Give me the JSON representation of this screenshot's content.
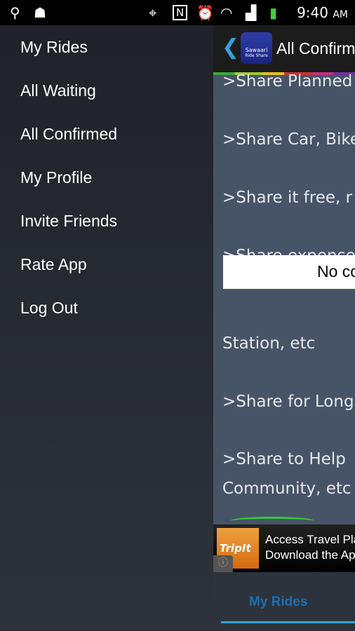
{
  "status_bar": {
    "time": "9:40",
    "ampm": "AM",
    "icons": [
      "usb-icon",
      "android-debug-icon",
      "gps-icon",
      "nfc-icon",
      "alarm-icon",
      "wifi-icon",
      "signal-icon",
      "battery-charging-icon"
    ]
  },
  "drawer": {
    "items": [
      {
        "label": "My Rides"
      },
      {
        "label": "All Waiting"
      },
      {
        "label": "All Confirmed"
      },
      {
        "label": "My Profile"
      },
      {
        "label": "Invite Friends"
      },
      {
        "label": "Rate App"
      },
      {
        "label": "Log Out"
      }
    ]
  },
  "action_bar": {
    "title": "All Confirmed",
    "logo_text": "Sawaari",
    "logo_sub": "Ride Share"
  },
  "content": {
    "lines": [
      ">Share Planned",
      ">Share Car, Bike",
      ">Share it free, r",
      ">Share expense",
      "Station, etc",
      ">Share for Long",
      ">Share to Help",
      "Community, etc"
    ]
  },
  "toast": "No confirmed rides",
  "ad": {
    "brand": "TripIt",
    "line1": "Access Travel Plans",
    "line2": "Download the App"
  },
  "tabs": {
    "active": "My Rides"
  },
  "colors": {
    "accent": "#33a0d8",
    "tab_text": "#1a6fb5",
    "content_bg": "#475468"
  }
}
